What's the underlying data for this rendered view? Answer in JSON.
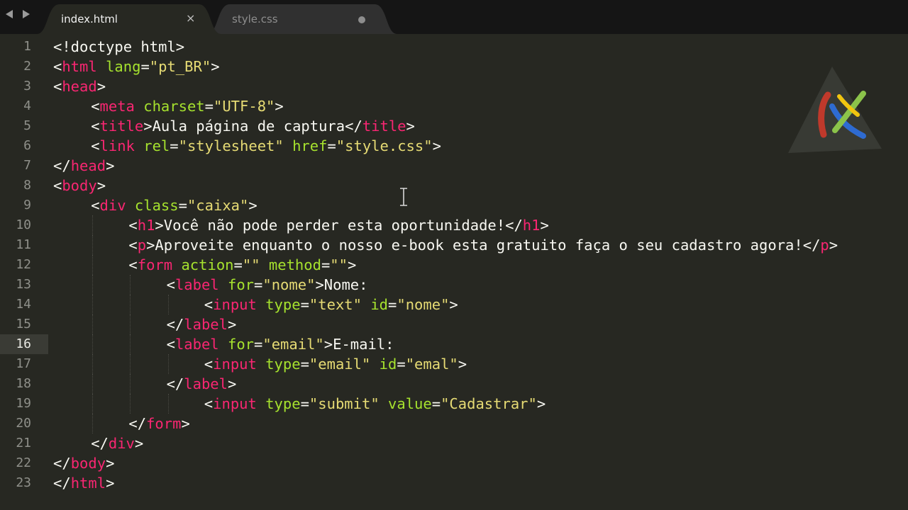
{
  "tabs": [
    {
      "label": "index.html",
      "active": true,
      "close_icon": "×"
    },
    {
      "label": "style.css",
      "active": false,
      "modified": true
    }
  ],
  "editor": {
    "active_line": 16,
    "colors": {
      "background": "#272822",
      "text": "#f8f8f2",
      "tag": "#f92672",
      "attribute": "#a6e22e",
      "string": "#e6db74",
      "gutter_text": "#8f908a"
    },
    "lines": [
      {
        "n": "1",
        "indent": 0,
        "tokens": [
          [
            "t",
            "<!doctype html>"
          ]
        ]
      },
      {
        "n": "2",
        "indent": 0,
        "tokens": [
          [
            "t",
            "<"
          ],
          [
            "g",
            "html"
          ],
          [
            "t",
            " "
          ],
          [
            "a",
            "lang"
          ],
          [
            "t",
            "="
          ],
          [
            "s",
            "\"pt_BR\""
          ],
          [
            "t",
            ">"
          ]
        ]
      },
      {
        "n": "3",
        "indent": 0,
        "tokens": [
          [
            "t",
            "<"
          ],
          [
            "g",
            "head"
          ],
          [
            "t",
            ">"
          ]
        ]
      },
      {
        "n": "4",
        "indent": 1,
        "tokens": [
          [
            "t",
            "<"
          ],
          [
            "g",
            "meta"
          ],
          [
            "t",
            " "
          ],
          [
            "a",
            "charset"
          ],
          [
            "t",
            "="
          ],
          [
            "s",
            "\"UTF-8\""
          ],
          [
            "t",
            ">"
          ]
        ]
      },
      {
        "n": "5",
        "indent": 1,
        "tokens": [
          [
            "t",
            "<"
          ],
          [
            "g",
            "title"
          ],
          [
            "t",
            ">Aula página de captura</"
          ],
          [
            "g",
            "title"
          ],
          [
            "t",
            ">"
          ]
        ]
      },
      {
        "n": "6",
        "indent": 1,
        "tokens": [
          [
            "t",
            "<"
          ],
          [
            "g",
            "link"
          ],
          [
            "t",
            " "
          ],
          [
            "a",
            "rel"
          ],
          [
            "t",
            "="
          ],
          [
            "s",
            "\"stylesheet\""
          ],
          [
            "t",
            " "
          ],
          [
            "a",
            "href"
          ],
          [
            "t",
            "="
          ],
          [
            "s",
            "\"style.css\""
          ],
          [
            "t",
            ">"
          ]
        ]
      },
      {
        "n": "7",
        "indent": 0,
        "tokens": [
          [
            "t",
            "</"
          ],
          [
            "g",
            "head"
          ],
          [
            "t",
            ">"
          ]
        ]
      },
      {
        "n": "8",
        "indent": 0,
        "tokens": [
          [
            "t",
            "<"
          ],
          [
            "g",
            "body"
          ],
          [
            "t",
            ">"
          ]
        ]
      },
      {
        "n": "9",
        "indent": 1,
        "tokens": [
          [
            "t",
            "<"
          ],
          [
            "g",
            "div"
          ],
          [
            "t",
            " "
          ],
          [
            "a",
            "class"
          ],
          [
            "t",
            "="
          ],
          [
            "s",
            "\"caixa\""
          ],
          [
            "t",
            ">"
          ]
        ]
      },
      {
        "n": "10",
        "indent": 2,
        "tokens": [
          [
            "t",
            "<"
          ],
          [
            "g",
            "h1"
          ],
          [
            "t",
            ">Você não pode perder esta oportunidade!</"
          ],
          [
            "g",
            "h1"
          ],
          [
            "t",
            ">"
          ]
        ]
      },
      {
        "n": "11",
        "indent": 2,
        "tokens": [
          [
            "t",
            "<"
          ],
          [
            "g",
            "p"
          ],
          [
            "t",
            ">Aproveite enquanto o nosso e-book esta gratuito faça o seu cadastro agora!</"
          ],
          [
            "g",
            "p"
          ],
          [
            "t",
            ">"
          ]
        ]
      },
      {
        "n": "12",
        "indent": 2,
        "tokens": [
          [
            "t",
            "<"
          ],
          [
            "g",
            "form"
          ],
          [
            "t",
            " "
          ],
          [
            "a",
            "action"
          ],
          [
            "t",
            "="
          ],
          [
            "s",
            "\"\""
          ],
          [
            "t",
            " "
          ],
          [
            "a",
            "method"
          ],
          [
            "t",
            "="
          ],
          [
            "s",
            "\"\""
          ],
          [
            "t",
            ">"
          ]
        ]
      },
      {
        "n": "13",
        "indent": 3,
        "tokens": [
          [
            "t",
            "<"
          ],
          [
            "g",
            "label"
          ],
          [
            "t",
            " "
          ],
          [
            "a",
            "for"
          ],
          [
            "t",
            "="
          ],
          [
            "s",
            "\"nome\""
          ],
          [
            "t",
            ">Nome:"
          ]
        ]
      },
      {
        "n": "14",
        "indent": 4,
        "tokens": [
          [
            "t",
            "<"
          ],
          [
            "g",
            "input"
          ],
          [
            "t",
            " "
          ],
          [
            "a",
            "type"
          ],
          [
            "t",
            "="
          ],
          [
            "s",
            "\"text\""
          ],
          [
            "t",
            " "
          ],
          [
            "a",
            "id"
          ],
          [
            "t",
            "="
          ],
          [
            "s",
            "\"nome\""
          ],
          [
            "t",
            ">"
          ]
        ]
      },
      {
        "n": "15",
        "indent": 3,
        "tokens": [
          [
            "t",
            "</"
          ],
          [
            "g",
            "label"
          ],
          [
            "t",
            ">"
          ]
        ]
      },
      {
        "n": "16",
        "indent": 3,
        "tokens": [
          [
            "t",
            "<"
          ],
          [
            "g",
            "label"
          ],
          [
            "t",
            " "
          ],
          [
            "a",
            "for"
          ],
          [
            "t",
            "="
          ],
          [
            "s",
            "\"email\""
          ],
          [
            "t",
            ">E-mail:"
          ]
        ]
      },
      {
        "n": "17",
        "indent": 4,
        "tokens": [
          [
            "t",
            "<"
          ],
          [
            "g",
            "input"
          ],
          [
            "t",
            " "
          ],
          [
            "a",
            "type"
          ],
          [
            "t",
            "="
          ],
          [
            "s",
            "\"email\""
          ],
          [
            "t",
            " "
          ],
          [
            "a",
            "id"
          ],
          [
            "t",
            "="
          ],
          [
            "s",
            "\"emal\""
          ],
          [
            "t",
            ">"
          ]
        ]
      },
      {
        "n": "18",
        "indent": 3,
        "tokens": [
          [
            "t",
            "</"
          ],
          [
            "g",
            "label"
          ],
          [
            "t",
            ">"
          ]
        ]
      },
      {
        "n": "19",
        "indent": 4,
        "tokens": [
          [
            "t",
            "<"
          ],
          [
            "g",
            "input"
          ],
          [
            "t",
            " "
          ],
          [
            "a",
            "type"
          ],
          [
            "t",
            "="
          ],
          [
            "s",
            "\"submit\""
          ],
          [
            "t",
            " "
          ],
          [
            "a",
            "value"
          ],
          [
            "t",
            "="
          ],
          [
            "s",
            "\"Cadastrar\""
          ],
          [
            "t",
            ">"
          ]
        ]
      },
      {
        "n": "20",
        "indent": 2,
        "tokens": [
          [
            "t",
            "</"
          ],
          [
            "g",
            "form"
          ],
          [
            "t",
            ">"
          ]
        ]
      },
      {
        "n": "21",
        "indent": 1,
        "tokens": [
          [
            "t",
            "</"
          ],
          [
            "g",
            "div"
          ],
          [
            "t",
            ">"
          ]
        ]
      },
      {
        "n": "22",
        "indent": 0,
        "tokens": [
          [
            "t",
            "</"
          ],
          [
            "g",
            "body"
          ],
          [
            "t",
            ">"
          ]
        ]
      },
      {
        "n": "23",
        "indent": 0,
        "tokens": [
          [
            "t",
            "</"
          ],
          [
            "g",
            "html"
          ],
          [
            "t",
            ">"
          ]
        ]
      }
    ]
  },
  "icons": {
    "back": "arrow-left-icon",
    "forward": "arrow-right-icon",
    "watermark": "channel-logo-icon",
    "cursor": "text-cursor-icon"
  }
}
